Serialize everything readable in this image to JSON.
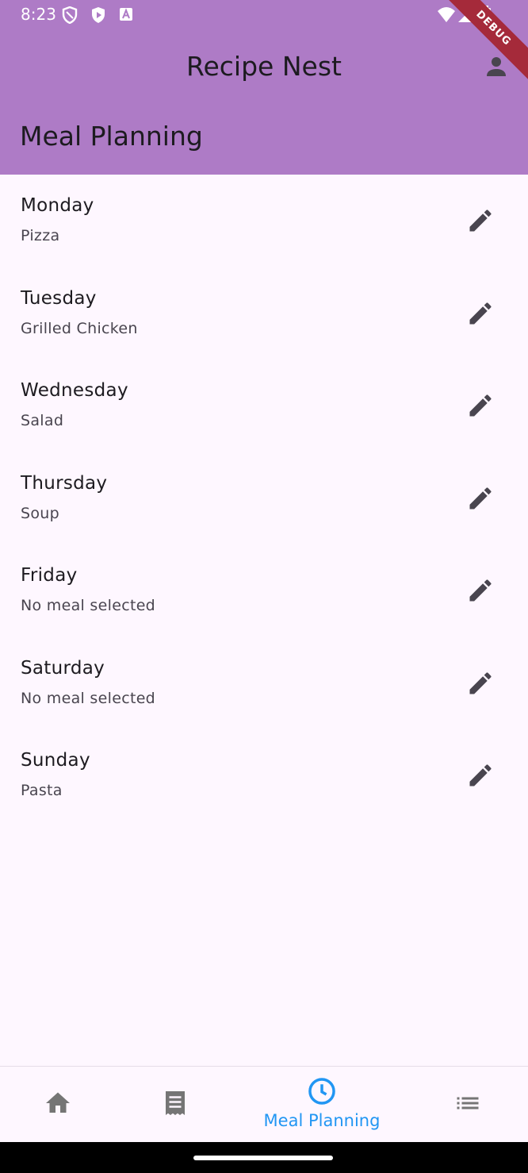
{
  "status_bar": {
    "time": "8:23"
  },
  "debug_banner": "DEBUG",
  "app_bar": {
    "title": "Recipe Nest",
    "page_heading": "Meal Planning"
  },
  "days": [
    {
      "day": "Monday",
      "meal": "Pizza"
    },
    {
      "day": "Tuesday",
      "meal": "Grilled Chicken"
    },
    {
      "day": "Wednesday",
      "meal": "Salad"
    },
    {
      "day": "Thursday",
      "meal": "Soup"
    },
    {
      "day": "Friday",
      "meal": "No meal selected"
    },
    {
      "day": "Saturday",
      "meal": "No meal selected"
    },
    {
      "day": "Sunday",
      "meal": "Pasta"
    }
  ],
  "bottom_nav": {
    "items": [
      {
        "icon": "home-icon"
      },
      {
        "icon": "receipt-icon"
      },
      {
        "icon": "clock-icon",
        "label": "Meal Planning",
        "selected": true
      },
      {
        "icon": "list-icon"
      }
    ]
  },
  "colors": {
    "app_bar": "#ae7bc6",
    "background": "#fef7ff",
    "accent": "#2196f3",
    "icon": "#49454f",
    "debug_banner": "#a52a3a"
  }
}
